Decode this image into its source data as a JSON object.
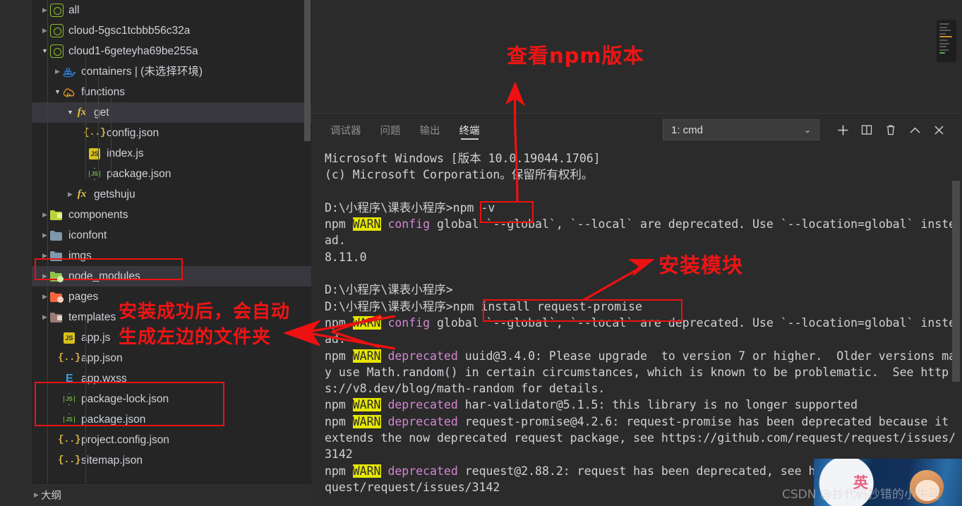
{
  "window": {
    "theme_bg": "#252526",
    "accent_red": "#ee1111",
    "warn_yellow": "#e6e600"
  },
  "explorer": {
    "tree": [
      {
        "label": "all",
        "icon": "cloud-env-icon",
        "indent": 0,
        "twisty": "collapsed",
        "selected": false
      },
      {
        "label": "cloud-5gsc1tcbbb56c32a",
        "icon": "cloud-env-icon",
        "indent": 0,
        "twisty": "collapsed",
        "selected": false
      },
      {
        "label": "cloud1-6geteyha69be255a",
        "icon": "cloud-env-icon",
        "indent": 0,
        "twisty": "expanded",
        "selected": false
      },
      {
        "label": "containers | (未选择环境)",
        "icon": "containers-icon",
        "indent": 1,
        "twisty": "collapsed",
        "selected": false
      },
      {
        "label": "functions",
        "icon": "functions-icon",
        "indent": 1,
        "twisty": "expanded",
        "selected": false
      },
      {
        "label": "get",
        "icon": "fx-icon",
        "indent": 2,
        "twisty": "expanded",
        "selected": true
      },
      {
        "label": "config.json",
        "icon": "json-icon",
        "indent": 3,
        "twisty": "none",
        "selected": false
      },
      {
        "label": "index.js",
        "icon": "js-icon",
        "indent": 3,
        "twisty": "none",
        "selected": false
      },
      {
        "label": "package.json",
        "icon": "node-icon",
        "indent": 3,
        "twisty": "none",
        "selected": false
      },
      {
        "label": "getshuju",
        "icon": "fx-icon",
        "indent": 2,
        "twisty": "collapsed",
        "selected": false
      },
      {
        "label": "components",
        "icon": "folder-components-icon",
        "indent": 0,
        "twisty": "collapsed",
        "selected": false
      },
      {
        "label": "iconfont",
        "icon": "folder-icon",
        "indent": 0,
        "twisty": "collapsed",
        "selected": false
      },
      {
        "label": "imgs",
        "icon": "folder-icon",
        "indent": 0,
        "twisty": "collapsed",
        "selected": false
      },
      {
        "label": "node_modules",
        "icon": "folder-node-icon",
        "indent": 0,
        "twisty": "collapsed",
        "selected": true
      },
      {
        "label": "pages",
        "icon": "folder-pages-icon",
        "indent": 0,
        "twisty": "collapsed",
        "selected": false
      },
      {
        "label": "templates",
        "icon": "folder-templates-icon",
        "indent": 0,
        "twisty": "collapsed",
        "selected": false
      },
      {
        "label": "app.js",
        "icon": "js-icon",
        "indent": 1,
        "twisty": "none",
        "selected": false
      },
      {
        "label": "app.json",
        "icon": "json-icon",
        "indent": 1,
        "twisty": "none",
        "selected": false
      },
      {
        "label": "app.wxss",
        "icon": "wxss-icon",
        "indent": 1,
        "twisty": "none",
        "selected": false
      },
      {
        "label": "package-lock.json",
        "icon": "node-icon",
        "indent": 1,
        "twisty": "none",
        "selected": false
      },
      {
        "label": "package.json",
        "icon": "node-icon",
        "indent": 1,
        "twisty": "none",
        "selected": false
      },
      {
        "label": "project.config.json",
        "icon": "json-icon",
        "indent": 1,
        "twisty": "none",
        "selected": false
      },
      {
        "label": "sitemap.json",
        "icon": "json-icon",
        "indent": 1,
        "twisty": "none",
        "selected": false
      }
    ],
    "outline_label": "大纲"
  },
  "panel": {
    "tabs": [
      {
        "label": "调试器",
        "active": false
      },
      {
        "label": "问题",
        "active": false
      },
      {
        "label": "输出",
        "active": false
      },
      {
        "label": "终端",
        "active": true
      }
    ],
    "terminal_selector": "1: cmd",
    "actions": [
      {
        "name": "new-terminal",
        "glyph": "+"
      },
      {
        "name": "split-terminal",
        "glyph": "▯"
      },
      {
        "name": "kill-terminal",
        "glyph": "🗑"
      },
      {
        "name": "collapse-panel",
        "glyph": "∧"
      },
      {
        "name": "close-panel",
        "glyph": "✕"
      }
    ]
  },
  "terminal": {
    "lines": [
      {
        "segments": [
          {
            "t": "Microsoft Windows [版本 10.0.19044.1706]"
          }
        ]
      },
      {
        "segments": [
          {
            "t": "(c) Microsoft Corporation。保留所有权利。"
          }
        ]
      },
      {
        "segments": [
          {
            "t": ""
          }
        ]
      },
      {
        "segments": [
          {
            "t": "D:\\小程序\\课表小程序>npm -v"
          }
        ]
      },
      {
        "segments": [
          {
            "t": "npm "
          },
          {
            "t": "WARN",
            "c": "warn"
          },
          {
            "t": " "
          },
          {
            "t": "config",
            "c": "mag"
          },
          {
            "t": " global `--global`, `--local` are deprecated. Use `--location=global` instead."
          }
        ]
      },
      {
        "segments": [
          {
            "t": "8.11.0"
          }
        ]
      },
      {
        "segments": [
          {
            "t": ""
          }
        ]
      },
      {
        "segments": [
          {
            "t": "D:\\小程序\\课表小程序>"
          }
        ]
      },
      {
        "segments": [
          {
            "t": "D:\\小程序\\课表小程序>npm install request-promise"
          }
        ]
      },
      {
        "segments": [
          {
            "t": "npm "
          },
          {
            "t": "WARN",
            "c": "warn"
          },
          {
            "t": " "
          },
          {
            "t": "config",
            "c": "mag"
          },
          {
            "t": " global `--global`, `--local` are deprecated. Use `--location=global` instead."
          }
        ]
      },
      {
        "segments": [
          {
            "t": "npm "
          },
          {
            "t": "WARN",
            "c": "warn"
          },
          {
            "t": " "
          },
          {
            "t": "deprecated",
            "c": "mag"
          },
          {
            "t": " uuid@3.4.0: Please upgrade  to version 7 or higher.  Older versions may use Math.random() in certain circumstances, which is known to be problematic.  See https://v8.dev/blog/math-random for details."
          }
        ]
      },
      {
        "segments": [
          {
            "t": "npm "
          },
          {
            "t": "WARN",
            "c": "warn"
          },
          {
            "t": " "
          },
          {
            "t": "deprecated",
            "c": "mag"
          },
          {
            "t": " har-validator@5.1.5: this library is no longer supported"
          }
        ]
      },
      {
        "segments": [
          {
            "t": "npm "
          },
          {
            "t": "WARN",
            "c": "warn"
          },
          {
            "t": " "
          },
          {
            "t": "deprecated",
            "c": "mag"
          },
          {
            "t": " request-promise@4.2.6: request-promise has been deprecated because it extends the now deprecated request package, see https://github.com/request/request/issues/3142"
          }
        ]
      },
      {
        "segments": [
          {
            "t": "npm "
          },
          {
            "t": "WARN",
            "c": "warn"
          },
          {
            "t": " "
          },
          {
            "t": "deprecated",
            "c": "mag"
          },
          {
            "t": " request@2.88.2: request has been deprecated, see https://github.com/request/request/issues/3142"
          }
        ]
      }
    ]
  },
  "annotations": {
    "check_npm_version": "查看npm版本",
    "install_module": "安装模块",
    "auto_generate_line1": "安装成功后，会自动",
    "auto_generate_line2": "生成左边的文件夹"
  },
  "watermark": {
    "text": "CSDN @抄代码抄错的小牛马",
    "avatar_label": "英"
  }
}
